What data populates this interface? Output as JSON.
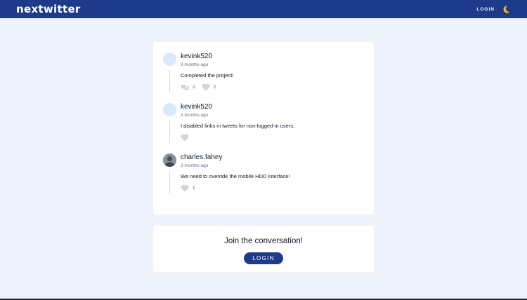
{
  "nav": {
    "brand": "nextwitter",
    "login_label": "LOGIN",
    "theme_icon": "moon-icon"
  },
  "tweets": [
    {
      "author": "kevink520",
      "time": "3 months ago",
      "content": "Completed the project!",
      "reply_count": "2",
      "like_count": "2",
      "avatar": "placeholder"
    },
    {
      "author": "kevink520",
      "time": "3 months ago",
      "content": "I disabled links in tweets for non-logged-in users.",
      "avatar": "placeholder"
    },
    {
      "author": "charles.fahey",
      "time": "3 months ago",
      "content": "We need to override the mobile HDD interface!",
      "like_count": "1",
      "avatar": "photo"
    }
  ],
  "join": {
    "text": "Join the conversation!",
    "login_label": "LOGIN"
  },
  "colors": {
    "brand": "#1e3a8a",
    "background": "#eef3fb",
    "moon": "#f2b705",
    "icon_gray": "#d1d5db"
  }
}
